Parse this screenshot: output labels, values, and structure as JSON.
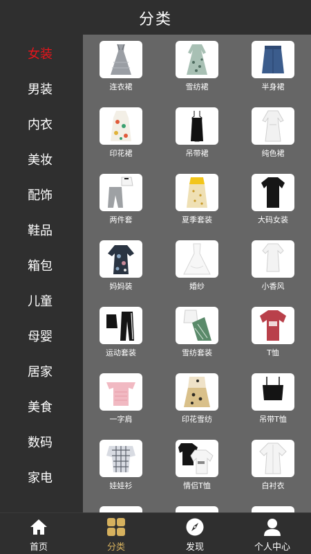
{
  "header": {
    "title": "分类"
  },
  "sidebar": {
    "items": [
      {
        "label": "女装",
        "active": true
      },
      {
        "label": "男装"
      },
      {
        "label": "内衣"
      },
      {
        "label": "美妆"
      },
      {
        "label": "配饰"
      },
      {
        "label": "鞋品"
      },
      {
        "label": "箱包"
      },
      {
        "label": "儿童"
      },
      {
        "label": "母婴"
      },
      {
        "label": "居家"
      },
      {
        "label": "美食"
      },
      {
        "label": "数码"
      },
      {
        "label": "家电"
      }
    ]
  },
  "grid": {
    "items": [
      {
        "label": "连衣裙",
        "icon": "gray-dress-icon"
      },
      {
        "label": "雪纺裙",
        "icon": "floral-chiffon-dress-icon"
      },
      {
        "label": "半身裙",
        "icon": "denim-skirt-icon"
      },
      {
        "label": "印花裙",
        "icon": "print-dress-icon"
      },
      {
        "label": "吊带裙",
        "icon": "black-slip-dress-icon"
      },
      {
        "label": "纯色裙",
        "icon": "white-dress-icon"
      },
      {
        "label": "两件套",
        "icon": "two-piece-set-icon"
      },
      {
        "label": "夏季套装",
        "icon": "summer-set-icon"
      },
      {
        "label": "大码女装",
        "icon": "black-tee-icon"
      },
      {
        "label": "妈妈装",
        "icon": "floral-top-icon"
      },
      {
        "label": "婚纱",
        "icon": "wedding-dress-icon"
      },
      {
        "label": "小香风",
        "icon": "white-mini-dress-icon"
      },
      {
        "label": "运动套装",
        "icon": "sport-set-icon"
      },
      {
        "label": "雪纺套装",
        "icon": "chiffon-set-icon"
      },
      {
        "label": "T恤",
        "icon": "red-tshirt-icon"
      },
      {
        "label": "一字肩",
        "icon": "pink-off-shoulder-icon"
      },
      {
        "label": "印花雪纺",
        "icon": "print-chiffon-icon"
      },
      {
        "label": "吊带T恤",
        "icon": "black-camisole-icon"
      },
      {
        "label": "娃娃衫",
        "icon": "plaid-doll-top-icon"
      },
      {
        "label": "情侣T恤",
        "icon": "couple-tshirts-icon"
      },
      {
        "label": "白衬衣",
        "icon": "white-blouse-icon"
      }
    ]
  },
  "tabbar": {
    "tabs": [
      {
        "label": "首页",
        "icon": "home-icon"
      },
      {
        "label": "分类",
        "icon": "category-grid-icon",
        "active": true
      },
      {
        "label": "发现",
        "icon": "compass-icon"
      },
      {
        "label": "个人中心",
        "icon": "user-icon"
      }
    ]
  },
  "colors": {
    "background": "#2f2f2f",
    "content_background": "#666666",
    "active_category": "#e8141b",
    "active_tab": "#d6b15e",
    "text": "#ffffff"
  }
}
